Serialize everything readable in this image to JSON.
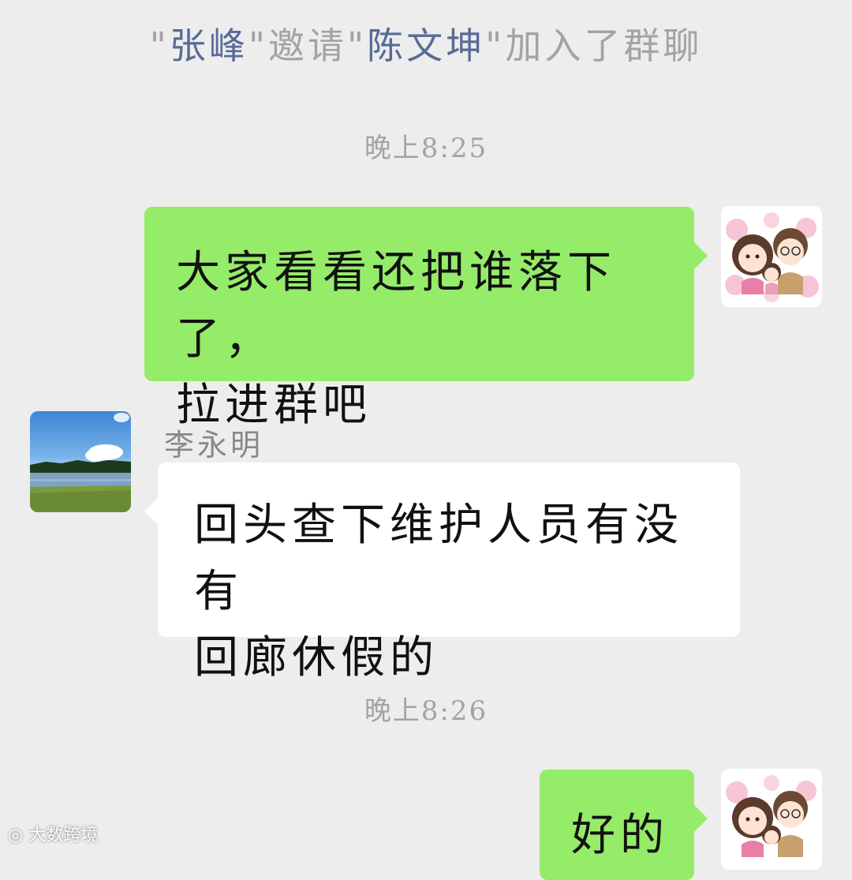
{
  "system_message": {
    "quote_open_1": "\"",
    "inviter": "张峰",
    "quote_close_1": "\"",
    "action": "邀请",
    "quote_open_2": "\"",
    "invitee": "陈文坤",
    "quote_close_2": "\"",
    "suffix": "加入了群聊"
  },
  "timestamps": [
    "晚上8:25",
    "晚上8:26"
  ],
  "messages": [
    {
      "sender": "self",
      "line1": "大家看看还把谁落下了，",
      "line2": "拉进群吧"
    },
    {
      "sender": "李永明",
      "line1": "回头查下维护人员有没有",
      "line2": "回廊休假的"
    },
    {
      "sender": "self",
      "line1": "好的"
    }
  ],
  "watermark": "大数跨境",
  "colors": {
    "background": "#ededed",
    "self_bubble": "#95ec69",
    "other_bubble": "#ffffff",
    "name_link": "#576b95",
    "meta_text": "#a3a3a3"
  }
}
